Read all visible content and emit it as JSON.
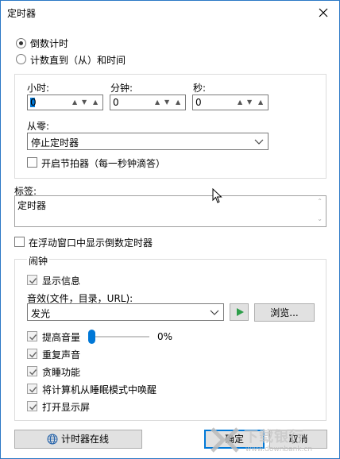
{
  "window": {
    "title": "定时器"
  },
  "mode": {
    "countdown_label": "倒数计时",
    "countto_label": "计数直到（从）和时间"
  },
  "time": {
    "hours_label": "小时:",
    "minutes_label": "分钟:",
    "seconds_label": "秒:",
    "hours_value": "0",
    "minutes_value": "0",
    "seconds_value": "0"
  },
  "from_zero": {
    "label": "从零:",
    "value": "停止定时器"
  },
  "metronome_label": "开启节拍器（每一秒钟滴答）",
  "tag": {
    "label": "标签:",
    "value": "定时器"
  },
  "floating_label": "在浮动窗口中显示倒数定时器",
  "alarm": {
    "group_label": "闹钟",
    "show_info_label": "显示信息",
    "sound_label": "音效(文件，目录，URL):",
    "sound_value": "发光",
    "browse_label": "浏览...",
    "raise_volume_label": "提高音量",
    "volume_percent": "0%",
    "volume_level": 0,
    "repeat_label": "重复声音",
    "snooze_label": "贪睡功能",
    "wake_label": "将计算机从睡眠模式中唤醒",
    "display_label": "打开显示屏"
  },
  "footer": {
    "online_label": "计时器在线",
    "ok_label": "确定",
    "cancel_label": "取消"
  },
  "watermark": {
    "text": "下载银行",
    "url": "www.downbank.cn"
  }
}
